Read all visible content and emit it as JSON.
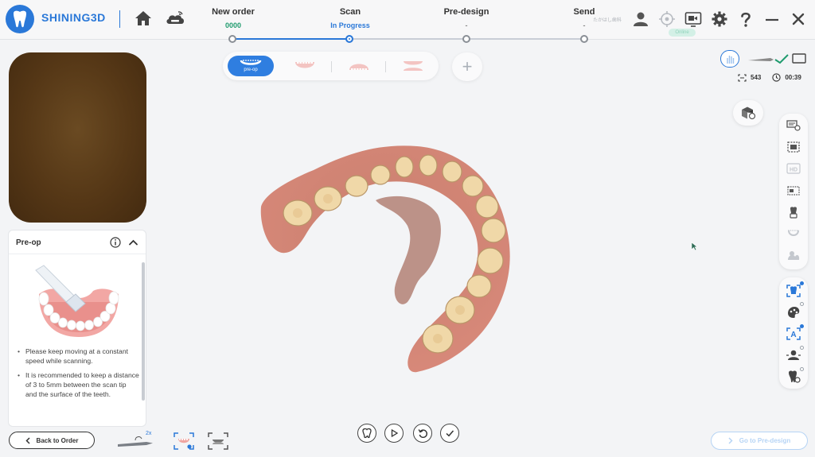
{
  "header": {
    "brand": "SHINING3D",
    "steps": [
      {
        "title": "New order",
        "status": "0000",
        "tone": "green"
      },
      {
        "title": "Scan",
        "status": "In Progress",
        "tone": "blue"
      },
      {
        "title": "Pre-design",
        "status": "-",
        "tone": "gray"
      },
      {
        "title": "Send",
        "status": "-",
        "tone": "gray"
      }
    ],
    "lab_name": "たかはし歯科",
    "connection_badge": "Online",
    "icons": [
      "home-icon",
      "cloud-sync-icon",
      "user-icon",
      "target-icon",
      "screen-record-icon",
      "gear-icon",
      "help-icon",
      "minimize-icon",
      "close-icon"
    ]
  },
  "jaw_selector": {
    "active_label": "pre-op",
    "items": [
      "pre-op",
      "upper-jaw",
      "lower-jaw",
      "bite"
    ]
  },
  "left_panel": {
    "card_title": "Pre-op",
    "tips": [
      "Please keep moving at a constant speed while scanning.",
      "It is recommended to keep a distance of 3 to 5mm between the scan tip and the surface of the teeth."
    ],
    "back_button": "Back to Order"
  },
  "status": {
    "frame_count": "543",
    "timer": "00:39"
  },
  "bottom": {
    "scanner_multiplier": "2x",
    "next_button": "Go to Pre-design"
  },
  "colors": {
    "accent": "#2a78d8",
    "success": "#1f9b6e",
    "disabled": "#b6d4f5"
  }
}
